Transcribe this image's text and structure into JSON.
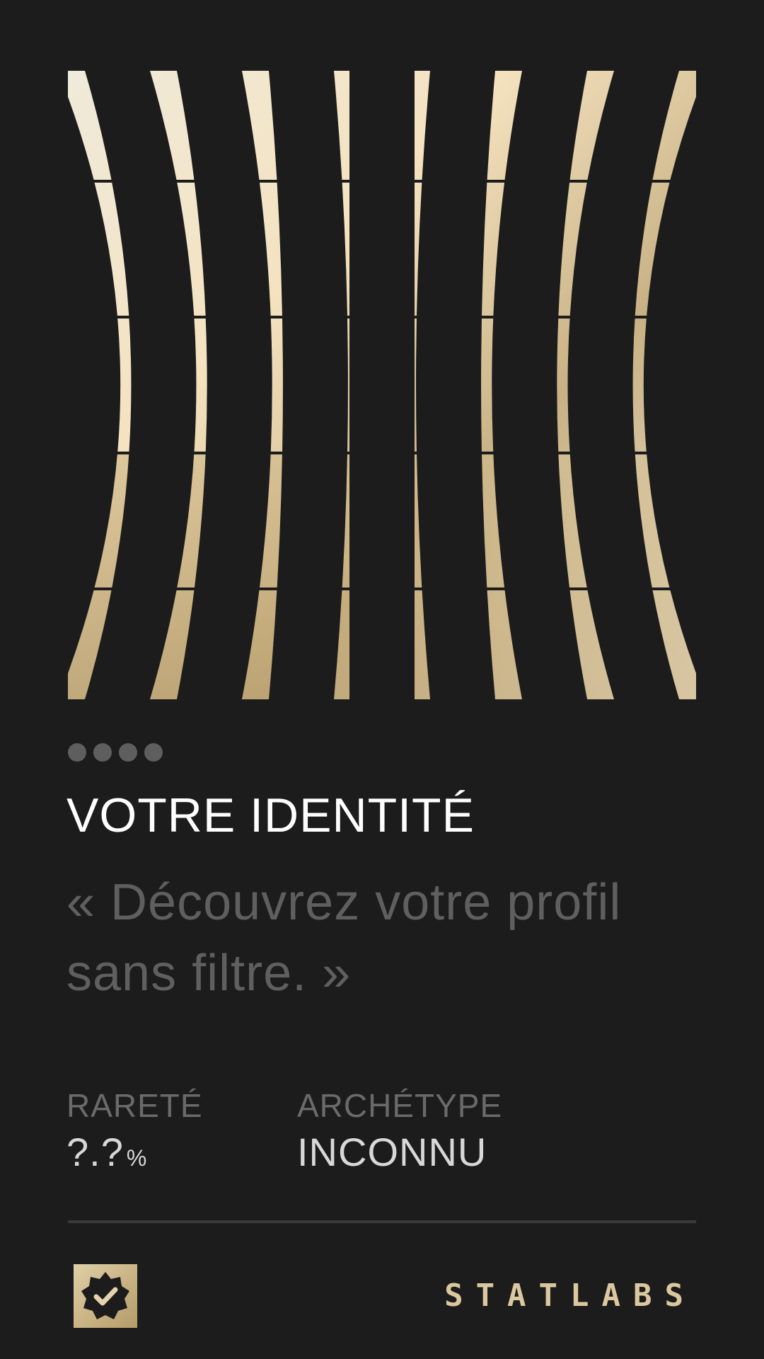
{
  "header": {
    "title": "VOTRE IDENTITÉ",
    "quote": "« Découvrez votre profil sans filtre. »"
  },
  "progress": {
    "total": 4
  },
  "stats": {
    "rarity": {
      "label": "RARETÉ",
      "value": "?.?",
      "unit": "%"
    },
    "archetype": {
      "label": "ARCHÉTYPE",
      "value": "INCONNU"
    }
  },
  "footer": {
    "badge_icon": "verified-badge-icon",
    "brand": "STATLABS"
  },
  "colors": {
    "background": "#1c1c1c",
    "gold_light": "#f3ead8",
    "gold_dark": "#b39c6b",
    "muted": "#5f5f5f"
  }
}
